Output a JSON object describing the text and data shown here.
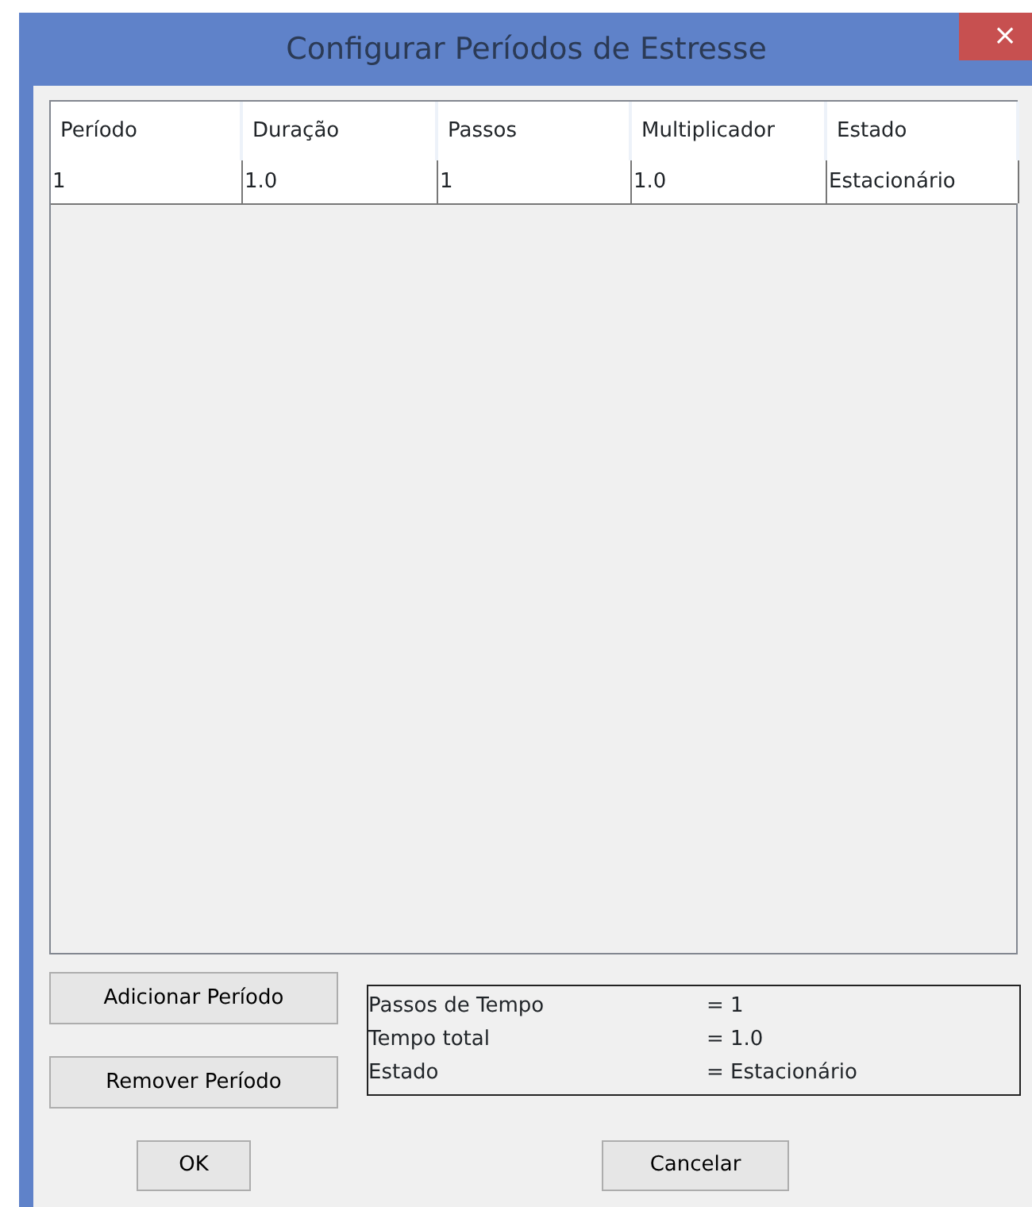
{
  "window": {
    "title": "Configurar Períodos de Estresse",
    "close": "×"
  },
  "table": {
    "columns": [
      "Período",
      "Duração",
      "Passos",
      "Multiplicador",
      "Estado"
    ],
    "rows": [
      [
        "1",
        "1.0",
        "1",
        "1.0",
        "Estacionário"
      ]
    ]
  },
  "buttons": [
    "Adicionar Período",
    "Remover Período"
  ],
  "summary": [
    {
      "label": "Passos de Tempo",
      "value": "= 1"
    },
    {
      "label": "Tempo total",
      "value": "= 1.0"
    },
    {
      "label": "Estado",
      "value": "= Estacionário"
    }
  ],
  "footer_buttons": [
    "OK",
    "Cancelar"
  ]
}
